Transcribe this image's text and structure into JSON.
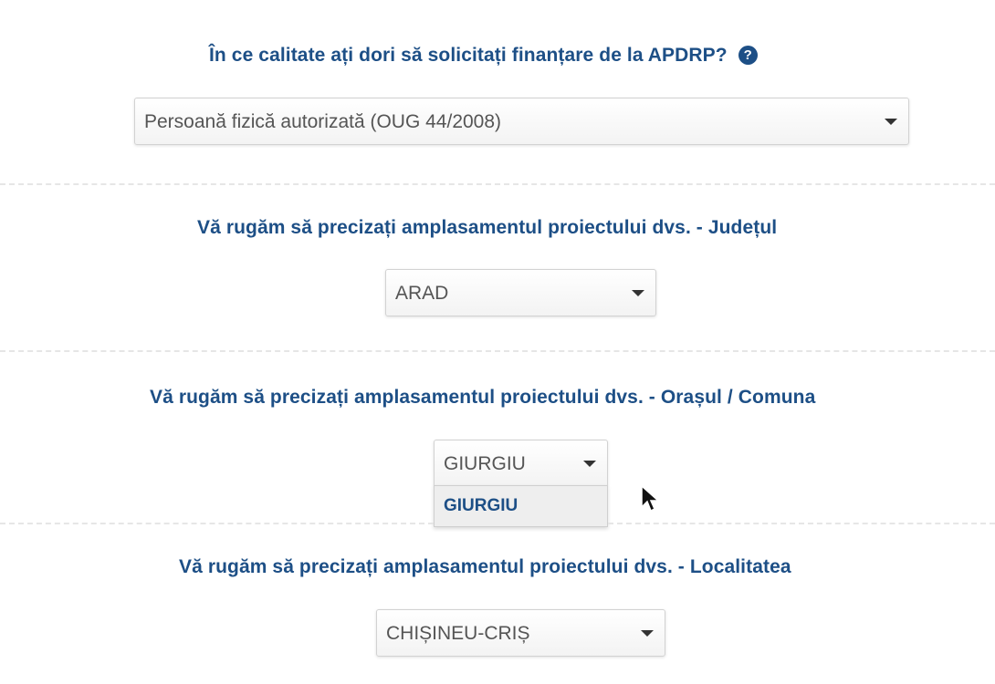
{
  "q1": {
    "label": "În ce calitate ați dori să solicitați finanțare de la APDRP?",
    "help_icon": "?",
    "selected": "Persoană fizică autorizată (OUG 44/2008)"
  },
  "q2": {
    "label": "Vă rugăm să precizați amplasamentul proiectului dvs. - Județul",
    "selected": "ARAD"
  },
  "q3": {
    "label": "Vă rugăm să precizați amplasamentul proiectului dvs. - Orașul / Comuna",
    "selected": "GIURGIU",
    "options": [
      "GIURGIU"
    ]
  },
  "q4": {
    "label": "Vă rugăm să precizați amplasamentul proiectului dvs. - Localitatea",
    "selected": "CHIȘINEU-CRIȘ"
  },
  "colors": {
    "label": "#1d4f86",
    "select_text": "#555555",
    "divider": "#e6e6e6"
  },
  "icons": {
    "help": "question-circle-icon",
    "dropdown_arrow": "caret-down-icon",
    "cursor": "mouse-pointer-icon"
  }
}
